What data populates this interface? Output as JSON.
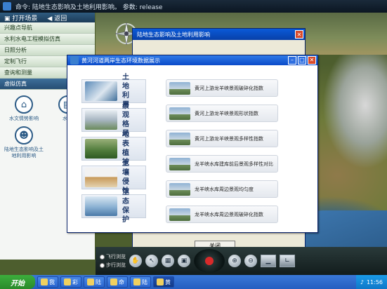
{
  "app": {
    "title": "命令: 陆地生态影响及土地利用影响。    参数: release"
  },
  "sidebar": {
    "open_scene": "打开场景",
    "back": "返回",
    "menu": [
      {
        "label": "兴趣点导航"
      },
      {
        "label": "水利水电工程模拟仿真"
      },
      {
        "label": "日照分析"
      },
      {
        "label": "定制飞行"
      },
      {
        "label": "查询和测量"
      },
      {
        "label": "虚拟仿真"
      }
    ],
    "tools": [
      {
        "label": "水文情势影响",
        "icon": "house-icon"
      },
      {
        "label": "水源",
        "icon": "document-icon"
      },
      {
        "label": "陆地生态影响及土地利用影响",
        "icon": "person-icon"
      }
    ]
  },
  "back_window": {
    "title": "陆地生态影响及土地利用影响",
    "close_button": "关闭"
  },
  "dialog": {
    "title": "黄河河道两岸生态环境数据展示",
    "categories": [
      {
        "label": "土地利用",
        "chars": [
          "土",
          "地",
          "利",
          "用"
        ]
      },
      {
        "label": "景观格局",
        "chars": [
          "景",
          "观",
          "格",
          "局"
        ]
      },
      {
        "label": "地表植被",
        "chars": [
          "地",
          "表",
          "植",
          "被"
        ]
      },
      {
        "label": "土壤侵蚀",
        "chars": [
          "土",
          "壤",
          "侵",
          "蚀"
        ]
      },
      {
        "label": "生态保护",
        "chars": [
          "生",
          "态",
          "保",
          "护"
        ]
      }
    ],
    "items": [
      {
        "label": "黄河上游龙羊峡景观破碎化指数"
      },
      {
        "label": "黄河上游龙羊峡景观形状指数"
      },
      {
        "label": "黄河上游龙羊峡景观多样性指数"
      },
      {
        "label": "龙羊峡水库建库前后景观多样性对比"
      },
      {
        "label": "龙羊峡水库周边景观均匀度"
      },
      {
        "label": "龙羊峡水库周边景观破碎化指数"
      }
    ]
  },
  "toolbar": {
    "radio": [
      "飞行浏览",
      "步行浏览"
    ]
  },
  "taskbar": {
    "start": "开始",
    "tasks": [
      "我",
      "彩",
      "陆",
      "命",
      "陆",
      "黄"
    ],
    "clock": "11:56"
  },
  "colors": {
    "titlebar": "#0a4ac8",
    "sidebar_active": "#264e73",
    "close": "#d94a2a"
  }
}
